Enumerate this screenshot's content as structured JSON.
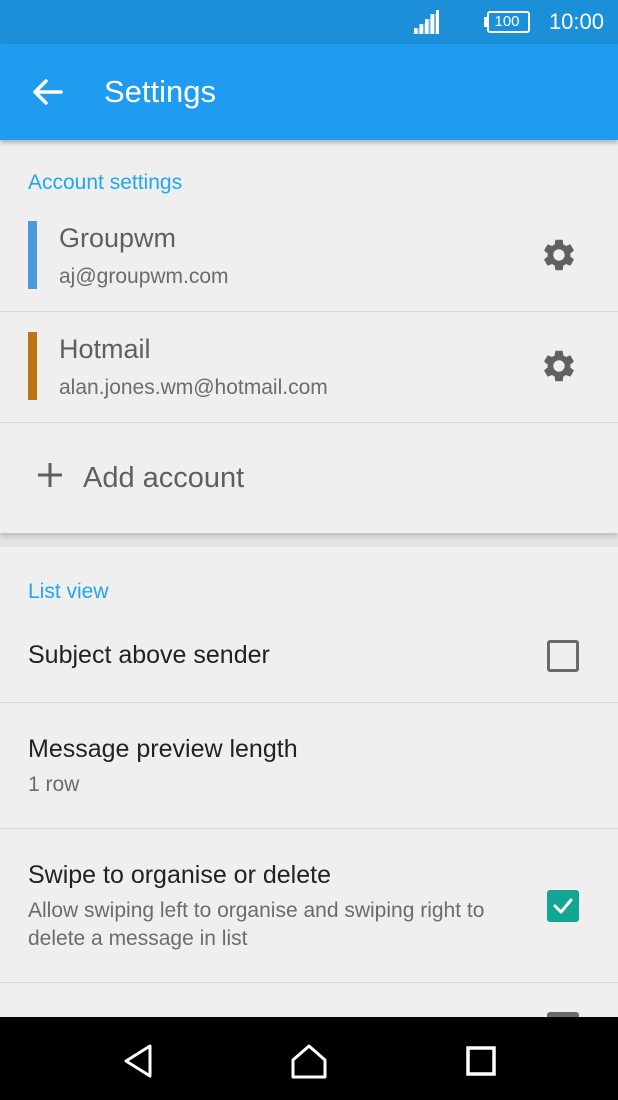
{
  "status_bar": {
    "battery": "100",
    "time": "10:00"
  },
  "app_bar": {
    "title": "Settings"
  },
  "account_settings": {
    "header": "Account settings",
    "accounts": [
      {
        "name": "Groupwm",
        "email": "aj@groupwm.com",
        "color": "#4a9bdc"
      },
      {
        "name": "Hotmail",
        "email": "alan.jones.wm@hotmail.com",
        "color": "#bd7511"
      }
    ],
    "add_label": "Add account"
  },
  "list_view": {
    "header": "List view",
    "items": [
      {
        "title": "Subject above sender",
        "checked": false
      },
      {
        "title": "Message preview length",
        "summary": "1 row"
      },
      {
        "title": "Swipe to organise or delete",
        "summary": "Allow swiping left to organise and swiping right to delete a message in list",
        "checked": true
      }
    ]
  },
  "colors": {
    "status_bar": "#1b8fd8",
    "app_bar": "#1f9cef",
    "accent": "#1fa7ef",
    "checkbox_checked": "#12a693"
  }
}
